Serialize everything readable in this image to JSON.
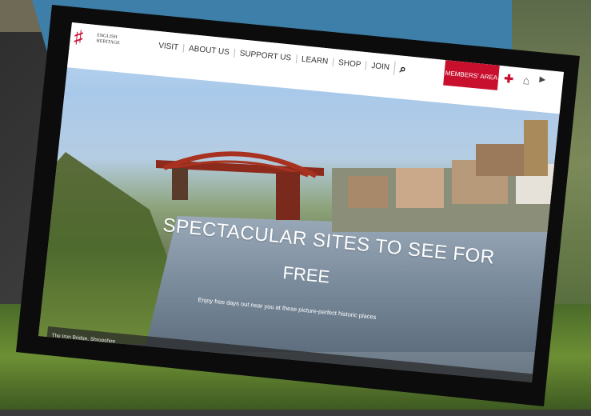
{
  "logo": {
    "line1": "ENGLISH",
    "line2": "HERITAGE",
    "mark": "♯"
  },
  "nav": {
    "items": [
      "VISIT",
      "ABOUT US",
      "SUPPORT US",
      "LEARN",
      "SHOP",
      "JOIN"
    ],
    "members_label": "MEMBERS' AREA"
  },
  "icons": {
    "search": "search-icon",
    "flag": "st-george-cross-icon",
    "basket": "basket-icon",
    "youtube": "youtube-icon"
  },
  "hero": {
    "title_line1": "SPECTACULAR SITES TO SEE FOR",
    "title_line2": "FREE",
    "subtitle": "Enjoy free days out near you at these picture-perfect historic places"
  },
  "caption": "The Iron Bridge, Shropshire",
  "colors": {
    "brand_red": "#c8102e",
    "backdrop_blue": "#3d7fa8"
  }
}
